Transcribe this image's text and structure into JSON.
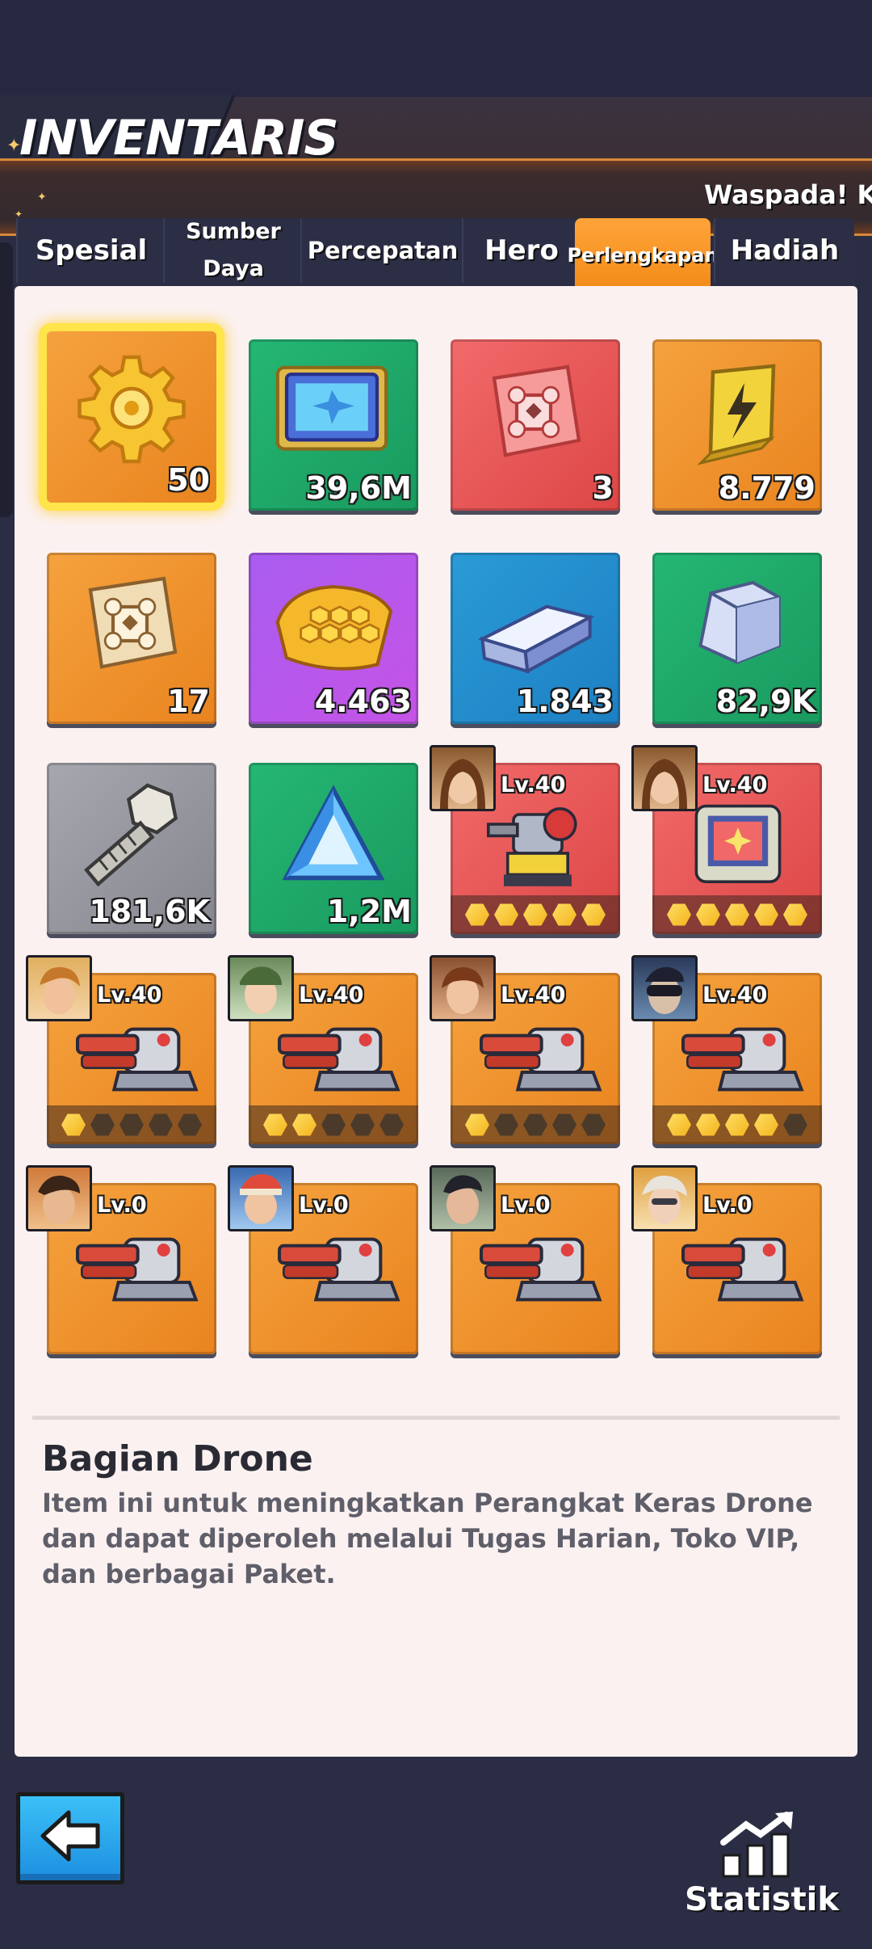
{
  "header": {
    "title": "INVENTARIS",
    "marquee": "Waspada! Kon"
  },
  "tabs": [
    {
      "label": "Spesial",
      "active": false
    },
    {
      "label": "Sumber Daya",
      "active": false
    },
    {
      "label": "Percepatan",
      "active": false
    },
    {
      "label": "Hero",
      "active": false
    },
    {
      "label": "Perlengkapan",
      "active": true
    },
    {
      "label": "Hadiah",
      "active": false
    }
  ],
  "items": [
    {
      "icon": "gear-icon",
      "bg": "orange",
      "qty": "50",
      "selected": true
    },
    {
      "icon": "drone-chip-icon",
      "bg": "green",
      "qty": "39,6M"
    },
    {
      "icon": "red-blueprint-icon",
      "bg": "red",
      "qty": "3"
    },
    {
      "icon": "lightning-battery-icon",
      "bg": "orange",
      "qty": "8.779"
    },
    {
      "icon": "gold-blueprint-icon",
      "bg": "orange",
      "qty": "17"
    },
    {
      "icon": "honeycomb-plate-icon",
      "bg": "purple",
      "qty": "4.463"
    },
    {
      "icon": "steel-bar-icon",
      "bg": "blue",
      "qty": "1.843"
    },
    {
      "icon": "metal-block-icon",
      "bg": "green",
      "qty": "82,9K"
    },
    {
      "icon": "bolt-icon",
      "bg": "gray",
      "qty": "181,6K"
    },
    {
      "icon": "crystal-triangle-icon",
      "bg": "green",
      "qty": "1,2M"
    },
    {
      "icon": "drone-robot-icon",
      "bg": "red",
      "level": "Lv.40",
      "stars": 5
    },
    {
      "icon": "drone-tablet-icon",
      "bg": "red",
      "level": "Lv.40",
      "stars": 5
    },
    {
      "icon": "cannon-icon",
      "bg": "orange",
      "level": "Lv.40",
      "stars": 1
    },
    {
      "icon": "cannon-icon",
      "bg": "orange",
      "level": "Lv.40",
      "stars": 2
    },
    {
      "icon": "cannon-icon",
      "bg": "orange",
      "level": "Lv.40",
      "stars": 1
    },
    {
      "icon": "cannon-icon",
      "bg": "orange",
      "level": "Lv.40",
      "stars": 4
    },
    {
      "icon": "cannon-icon",
      "bg": "orange",
      "level": "Lv.0"
    },
    {
      "icon": "cannon-icon",
      "bg": "orange",
      "level": "Lv.0"
    },
    {
      "icon": "cannon-icon",
      "bg": "orange",
      "level": "Lv.0"
    },
    {
      "icon": "cannon-icon",
      "bg": "orange",
      "level": "Lv.0"
    }
  ],
  "description": {
    "title": "Bagian Drone",
    "text": "Item ini untuk meningkatkan Perangkat Keras Drone dan dapat diperoleh melalui Tugas Harian, Toko VIP, dan berbagai Paket."
  },
  "footer": {
    "back_icon": "arrow-left-icon",
    "stat_label": "Statistik",
    "stat_icon": "bar-chart-icon"
  }
}
